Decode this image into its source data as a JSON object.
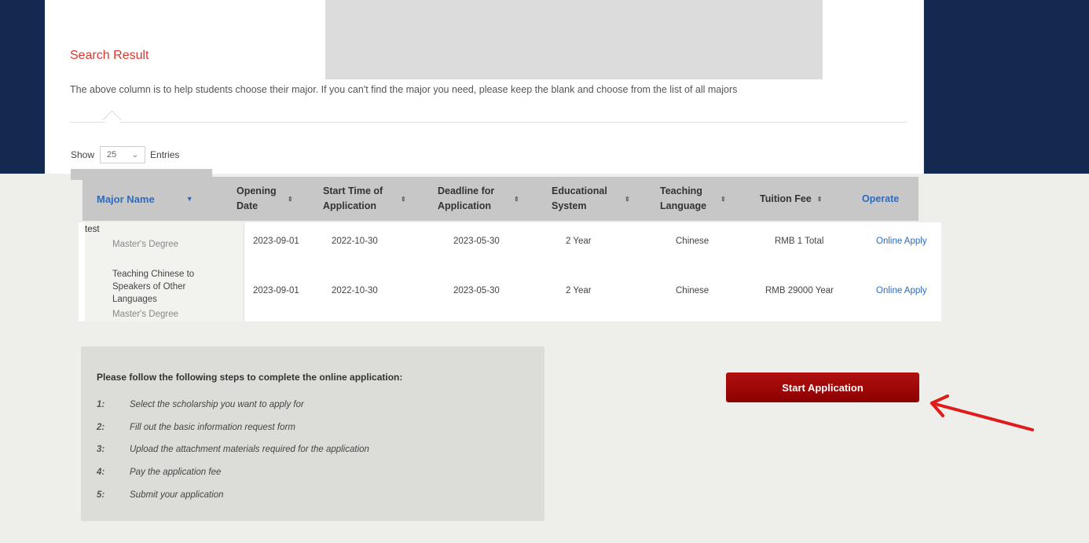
{
  "search": {
    "title": "Search Result",
    "description": "The above column is to help students choose their major. If you can't find the major you need, please keep the blank and choose from the list of all majors",
    "show_label": "Show",
    "entries_value": "25",
    "entries_label": "Entries"
  },
  "table": {
    "headers": [
      "Major Name",
      "Opening Date",
      "Start Time of Application",
      "Deadline for Application",
      "Educational System",
      "Teaching Language",
      "Tuition Fee",
      "Operate"
    ],
    "rows": [
      {
        "name": "test",
        "degree": "Master's Degree",
        "opening": "2023-09-01",
        "start": "2022-10-30",
        "deadline": "2023-05-30",
        "system": "2 Year",
        "language": "Chinese",
        "fee": "RMB 1 Total",
        "operate": "Online Apply"
      },
      {
        "name": "Teaching Chinese to Speakers of Other Languages",
        "degree": "Master's Degree",
        "opening": "2023-09-01",
        "start": "2022-10-30",
        "deadline": "2023-05-30",
        "system": "2 Year",
        "language": "Chinese",
        "fee": "RMB 29000 Year",
        "operate": "Online Apply"
      }
    ]
  },
  "steps": {
    "title": "Please follow the following steps to complete the online application:",
    "items": [
      {
        "num": "1:",
        "text": "Select the scholarship you want to apply for"
      },
      {
        "num": "2:",
        "text": "Fill out the basic information request form"
      },
      {
        "num": "3:",
        "text": "Upload the attachment materials required for the application"
      },
      {
        "num": "4:",
        "text": "Pay the application fee"
      },
      {
        "num": "5:",
        "text": "Submit your application"
      }
    ]
  },
  "actions": {
    "start_label": "Start Application"
  },
  "colors": {
    "background": "#13294f",
    "title_red": "#e0352b",
    "link_blue": "#2c6bbf",
    "button_red": "#a00a0a",
    "arrow_red": "#e01b1b"
  }
}
